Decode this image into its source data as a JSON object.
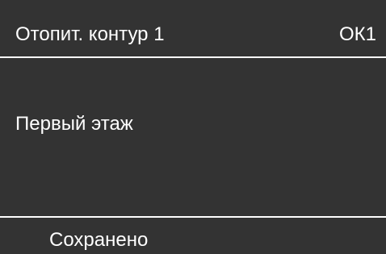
{
  "header": {
    "title": "Отопит. контур 1",
    "code": "ОК1"
  },
  "main": {
    "value": "Первый этаж"
  },
  "footer": {
    "status": "Сохранено"
  },
  "colors": {
    "background": "#333333",
    "text": "#ffffff",
    "divider": "#ffffff"
  }
}
